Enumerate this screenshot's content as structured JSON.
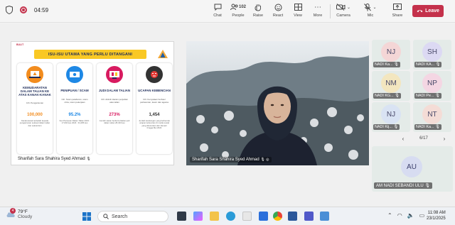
{
  "meeting": {
    "timer": "04:59",
    "toolbar": {
      "chat": "Chat",
      "people": "People",
      "people_count": "102",
      "raise": "Raise",
      "react": "React",
      "view": "View",
      "more": "More",
      "camera": "Camera",
      "mic": "Mic",
      "share": "Share",
      "leave": "Leave"
    }
  },
  "share_tile": {
    "slide_tag": "BULIT",
    "slide_title": "ISU-ISU UTAMA YANG PERLU DITANGANI",
    "cards": [
      {
        "title": "KEMUDARATAN DALAM TALIAN KE ATAS KANAK-KANAK",
        "example": "Cth: Pengantunan",
        "value": "100,000",
        "note": "Kanak-kanak terdedah kepada pengantunan seksual dalam talian dan sekstortion"
      },
      {
        "title": "PENIPUAN / SCAM",
        "example": "Cth: Scam pelaburan, scam cinta, scam pekerjaan",
        "value": "95.2%",
        "note": "Kes Penipuan Dalam Talian 2023 : 17,604 kes 2024 : 34,495 kes"
      },
      {
        "title": "JUDI DALAM TALIAN",
        "example": "Cth: Aktiviti Haram perjudian atas talian",
        "value": "273%",
        "note": "Jumlah siaran berita berkaitan judi dalam talian 28,433 kes"
      },
      {
        "title": "UCAPAN KEBENCIAN",
        "example": "Cth: Kenyataan berbaur perkauman, kaum dan agama",
        "value": "1,454",
        "note": "Jumlah kandungan yang berbentuk ucapan kebencian di media sosial yang diturunkan dari Januari hingga Mei 2024"
      }
    ],
    "presenter_name": "Sharifah Sara Shahira Syed Ahmad"
  },
  "video_tile": {
    "name": "Sharifah Sara Shahira Syed Ahmad"
  },
  "gallery": {
    "tiles": [
      {
        "initials": "NJ",
        "name": "NADI Ka..."
      },
      {
        "initials": "SH",
        "name": "NADI KA..."
      },
      {
        "initials": "NM",
        "name": "NADI KG..."
      },
      {
        "initials": "NP",
        "name": "NADI Pe..."
      },
      {
        "initials": "NJ",
        "name": "NADI Kij..."
      },
      {
        "initials": "NT",
        "name": "NADI Ka..."
      }
    ],
    "page": "6/17",
    "featured": {
      "initials": "AU",
      "name": "AM NADI SEBANDI ULU"
    }
  },
  "taskbar": {
    "notification_count": "4",
    "temperature": "79°F",
    "weather": "Cloudy",
    "search_placeholder": "Search",
    "time": "11:08 AM",
    "date": "23/1/2025"
  },
  "colors": {
    "leave": "#c4314b",
    "slide_banner": "#f9c824",
    "card_value_colors": [
      "#f28c1e",
      "#1e88e5",
      "#d81b60",
      "#333333"
    ]
  }
}
